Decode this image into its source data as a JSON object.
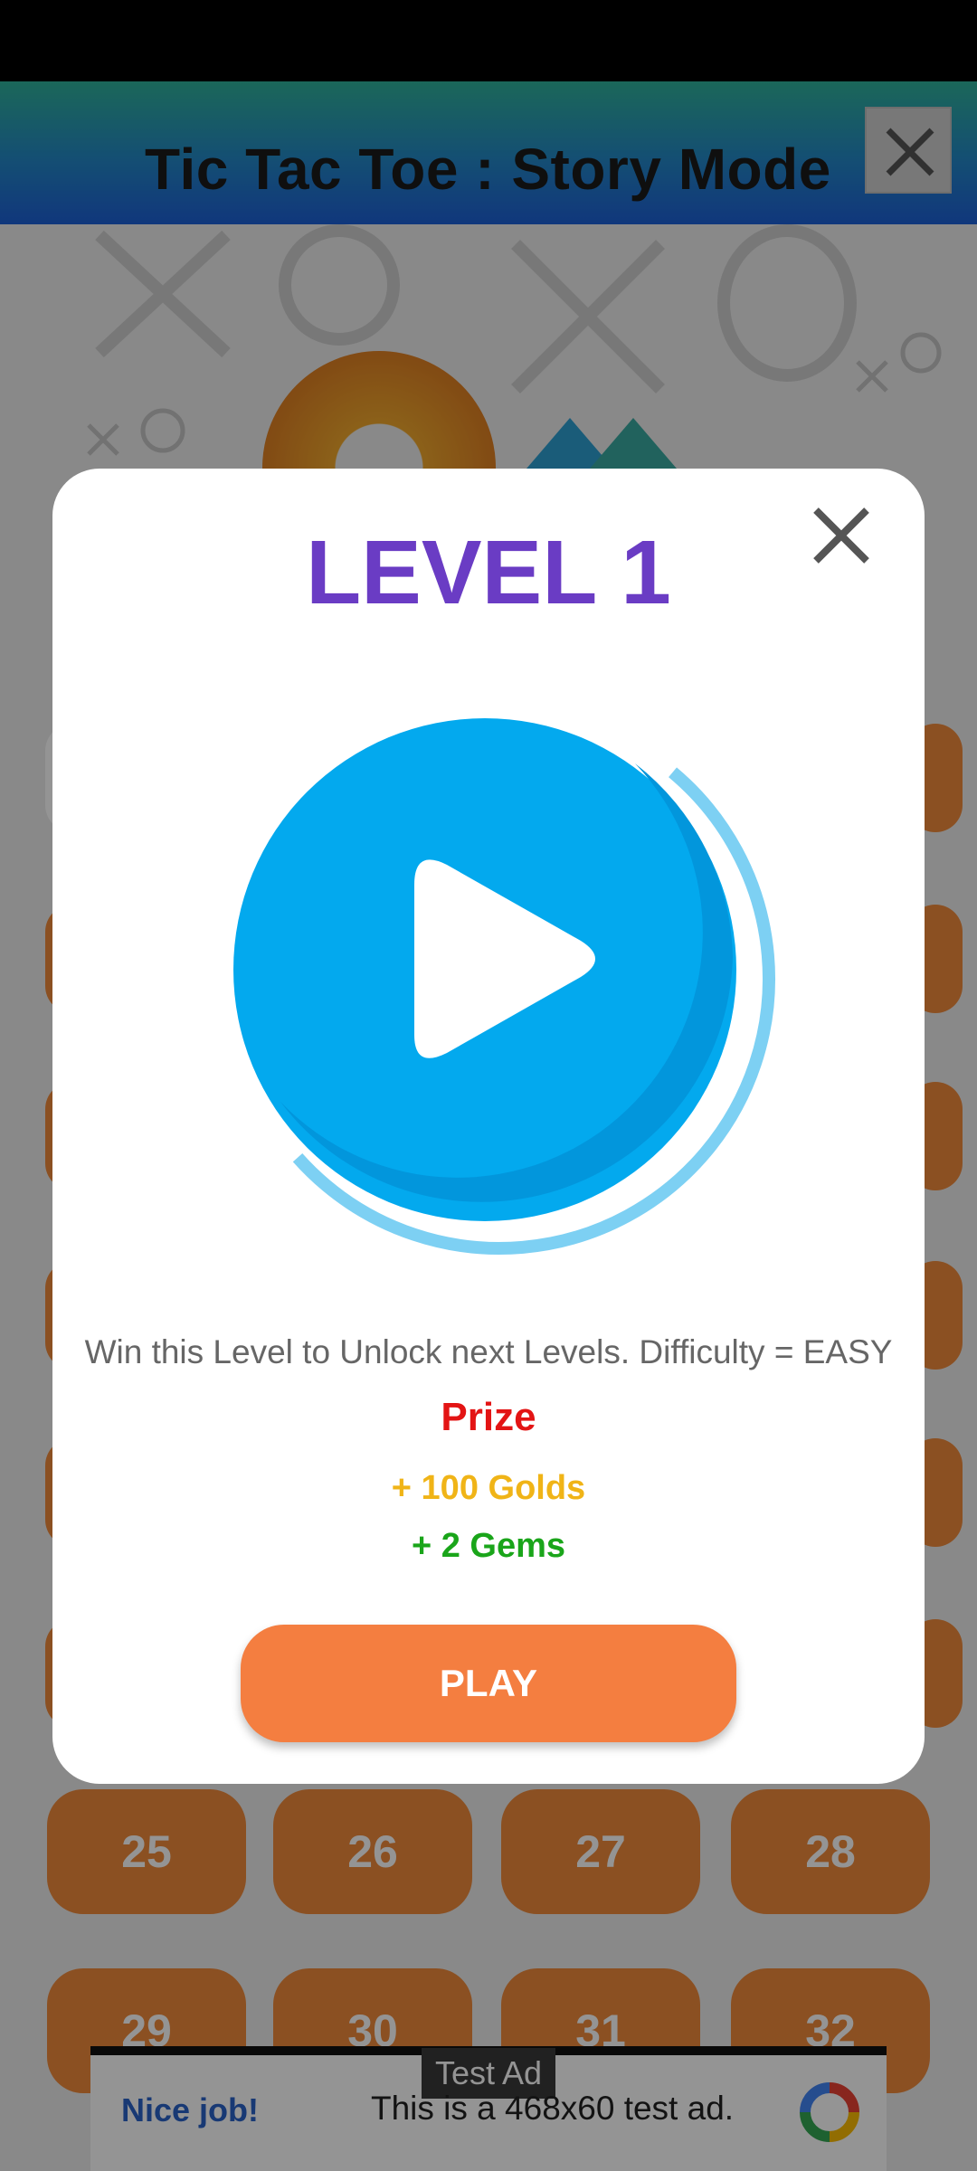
{
  "app": {
    "title": "Tic Tac Toe : Story Mode",
    "header_close_icon": "close-icon"
  },
  "level_grid": {
    "visible_levels": [
      "25",
      "26",
      "27",
      "28",
      "29",
      "30",
      "31",
      "32"
    ]
  },
  "dialog": {
    "title": "LEVEL 1",
    "play_icon": "play-circle-icon",
    "close_icon": "close-icon",
    "description": "Win this Level to Unlock next Levels. Difficulty = EASY",
    "prize_label": "Prize",
    "prize_gold": "+ 100 Golds",
    "prize_gems": "+ 2 Gems",
    "play_label": "PLAY"
  },
  "ad": {
    "label": "Test Ad",
    "headline": "Nice job!",
    "text": "This is a 468x60 test ad."
  },
  "colors": {
    "title_purple": "#6a3cc4",
    "play_blue": "#03a9ee",
    "prize_red": "#e31414",
    "gold": "#f0b417",
    "gems_green": "#1aa51a",
    "play_orange": "#f47e40",
    "level_orange": "#f08a3b"
  }
}
